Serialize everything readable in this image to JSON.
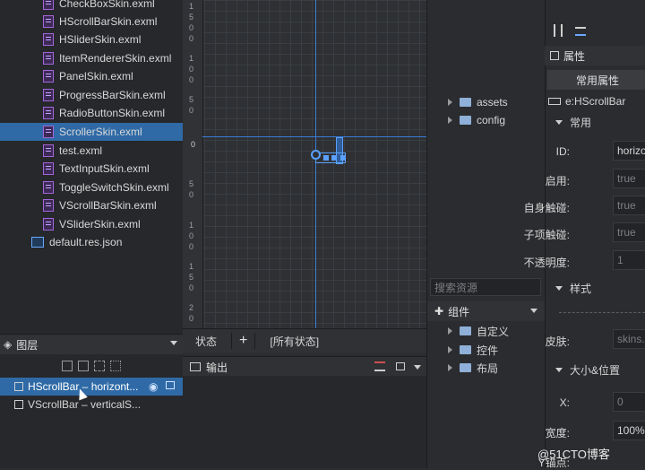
{
  "files": [
    {
      "label": "CheckBoxSkin.exml",
      "selected": false
    },
    {
      "label": "HScrollBarSkin.exml",
      "selected": false
    },
    {
      "label": "HSliderSkin.exml",
      "selected": false
    },
    {
      "label": "ItemRendererSkin.exml",
      "selected": false
    },
    {
      "label": "PanelSkin.exml",
      "selected": false
    },
    {
      "label": "ProgressBarSkin.exml",
      "selected": false
    },
    {
      "label": "RadioButtonSkin.exml",
      "selected": false
    },
    {
      "label": "ScrollerSkin.exml",
      "selected": true
    },
    {
      "label": "test.exml",
      "selected": false
    },
    {
      "label": "TextInputSkin.exml",
      "selected": false
    },
    {
      "label": "ToggleSwitchSkin.exml",
      "selected": false
    },
    {
      "label": "VScrollBarSkin.exml",
      "selected": false
    },
    {
      "label": "VSliderSkin.exml",
      "selected": false
    },
    {
      "label": "default.res.json",
      "selected": false
    }
  ],
  "layers": {
    "title": "图层",
    "items": [
      {
        "label": "HScrollBar – horizont...",
        "selected": true
      },
      {
        "label": "VScrollBar – verticalS...",
        "selected": false
      }
    ]
  },
  "ruler": [
    "1",
    "5",
    "0",
    "0",
    "1",
    "0",
    "0",
    "5",
    "0",
    "5",
    "0",
    "1",
    "0",
    "0",
    "1",
    "5",
    "0",
    "2",
    "0"
  ],
  "state_bar": {
    "state_label": "状态",
    "add": "+",
    "all_states": "[所有状态]"
  },
  "output": {
    "title": "输出"
  },
  "resources": {
    "folders": [
      "assets",
      "config"
    ],
    "search_placeholder": "搜索资源",
    "components_title": "组件",
    "component_folders": [
      "自定义",
      "控件",
      "布局"
    ]
  },
  "properties": {
    "tab": "属性",
    "common_title": "常用属性",
    "element": "e:HScrollBar",
    "section_common": "常用",
    "fields": [
      {
        "label": "ID:",
        "value": "horizontal"
      },
      {
        "label": "启用:",
        "value": "true"
      },
      {
        "label": "自身触碰:",
        "value": "true"
      },
      {
        "label": "子项触碰:",
        "value": "true"
      },
      {
        "label": "不透明度:",
        "value": "1"
      }
    ],
    "section_style": "样式",
    "skin_label": "皮肤:",
    "skin_value": "skins.",
    "section_size": "大小&位置",
    "x_label": "X:",
    "x_value": "0",
    "width_label": "宽度:",
    "width_value": "100%",
    "anchor_label": "Y锚点:"
  },
  "watermark": "@51CTO博客"
}
